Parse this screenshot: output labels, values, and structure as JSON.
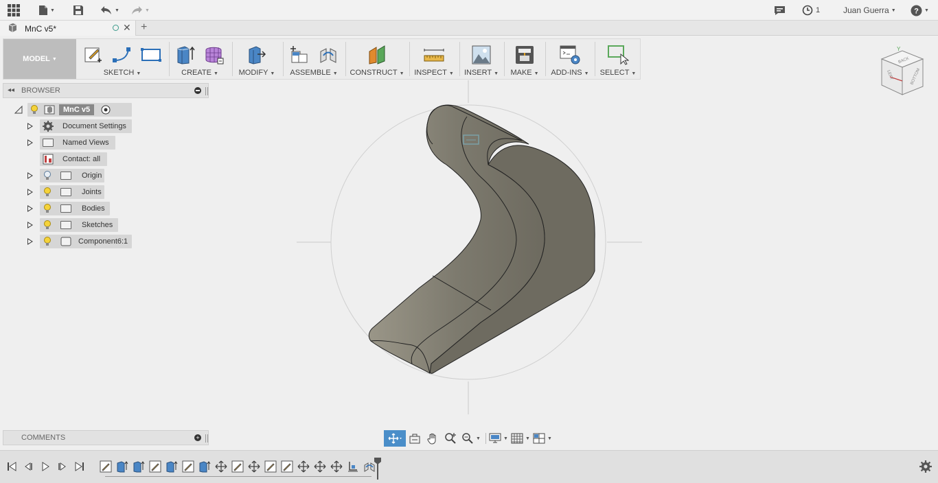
{
  "app": {
    "user_name": "Juan Guerra",
    "jobs_count": "1",
    "icons": [
      "apps-grid-icon",
      "file-icon",
      "save-icon",
      "undo-icon",
      "redo-icon",
      "comment-icon",
      "clock-icon",
      "help-icon"
    ]
  },
  "tab": {
    "title": "MnC v5*",
    "close": "✕",
    "new_tab": "+"
  },
  "toolbar": {
    "workspace": "MODEL",
    "groups": {
      "sketch": "SKETCH",
      "create": "CREATE",
      "modify": "MODIFY",
      "assemble": "ASSEMBLE",
      "construct": "CONSTRUCT",
      "inspect": "INSPECT",
      "insert": "INSERT",
      "make": "MAKE",
      "addins": "ADD-INS",
      "select": "SELECT"
    }
  },
  "browser": {
    "title": "BROWSER",
    "root": "MnC v5",
    "items": [
      {
        "label": "Document Settings"
      },
      {
        "label": "Named Views"
      },
      {
        "label": "Contact: all"
      },
      {
        "label": "Origin"
      },
      {
        "label": "Joints"
      },
      {
        "label": "Bodies"
      },
      {
        "label": "Sketches"
      },
      {
        "label": "Component6:1"
      }
    ]
  },
  "comments": {
    "title": "COMMENTS"
  },
  "viewcube": {
    "top": "Y",
    "face_back": "BACK",
    "face_bottom": "BOTTOM",
    "face_left": "LEFT"
  },
  "colors": {
    "accent": "#4a8ec9",
    "body_fill": "#8a8678",
    "panel": "#e2e2e2"
  }
}
